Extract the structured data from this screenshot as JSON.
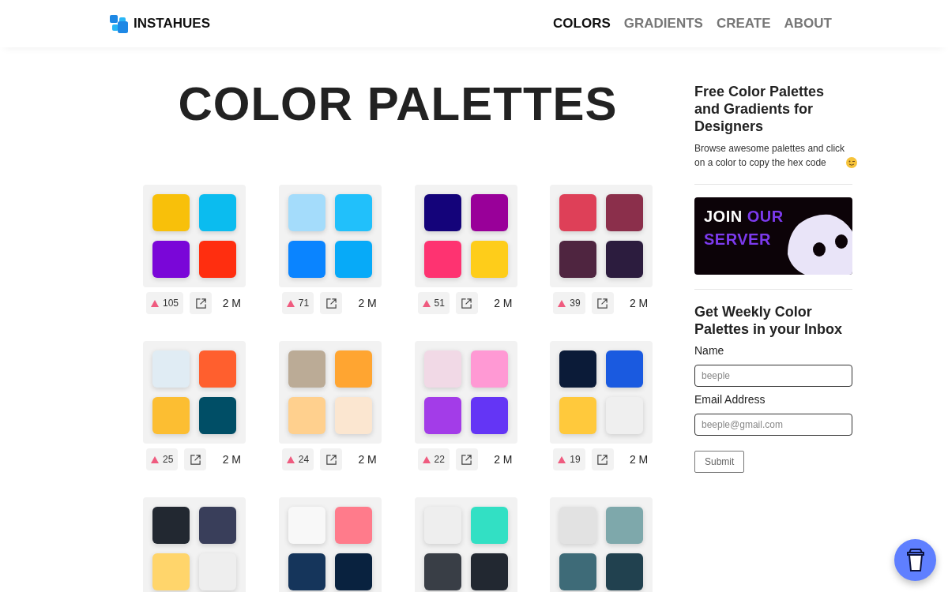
{
  "brand": "INSTAHUES",
  "nav": [
    {
      "label": "COLORS",
      "selected": true
    },
    {
      "label": "GRADIENTS",
      "selected": false
    },
    {
      "label": "CREATE",
      "selected": false
    },
    {
      "label": "ABOUT",
      "selected": false
    }
  ],
  "title": "COLOR PALETTES",
  "palettes": [
    {
      "swatches": [
        {
          "color": "#f8c00a"
        },
        {
          "color": "#0bbcef"
        },
        {
          "color": "#7a06d8"
        },
        {
          "color": "#ff2e0f"
        }
      ],
      "likes": "105",
      "views": "2 M"
    },
    {
      "swatches": [
        {
          "color": "#a4dcfb"
        },
        {
          "color": "#21c0fb"
        },
        {
          "color": "#0a84ff"
        },
        {
          "color": "#07aaf8"
        }
      ],
      "likes": "71",
      "views": "2 M"
    },
    {
      "swatches": [
        {
          "color": "#14037a"
        },
        {
          "color": "#990099"
        },
        {
          "color": "#fe3371"
        },
        {
          "color": "#fecd1a"
        }
      ],
      "likes": "51",
      "views": "2 M"
    },
    {
      "swatches": [
        {
          "color": "#de4058"
        },
        {
          "color": "#8b2f4b"
        },
        {
          "color": "#4f2540"
        },
        {
          "color": "#2c1c3e"
        }
      ],
      "likes": "39",
      "views": "2 M"
    },
    {
      "swatches": [
        {
          "color": "#e0ecf4"
        },
        {
          "color": "#ff5f2e"
        },
        {
          "color": "#fcbe32"
        },
        {
          "color": "#004e66"
        }
      ],
      "likes": "25",
      "views": "2 M"
    },
    {
      "swatches": [
        {
          "color": "#bbab96"
        },
        {
          "color": "#ffa531"
        },
        {
          "color": "#ffd08e"
        },
        {
          "color": "#fbe6d0"
        }
      ],
      "likes": "24",
      "views": "2 M"
    },
    {
      "swatches": [
        {
          "color": "#f1d9e6"
        },
        {
          "color": "#ff99d4"
        },
        {
          "color": "#a33ce8"
        },
        {
          "color": "#6435f5"
        }
      ],
      "likes": "22",
      "views": "2 M"
    },
    {
      "swatches": [
        {
          "color": "#0b1b38"
        },
        {
          "color": "#1a5ae0"
        },
        {
          "color": "#ffc93c"
        },
        {
          "color": "#efefef"
        }
      ],
      "likes": "19",
      "views": "2 M"
    },
    {
      "swatches": [
        {
          "color": "#222831"
        },
        {
          "color": "#393e5a"
        },
        {
          "color": "#ffd56b"
        },
        {
          "color": "#eeeeee"
        }
      ]
    },
    {
      "swatches": [
        {
          "color": "#f8f8f8"
        },
        {
          "color": "#ff7b8b"
        },
        {
          "color": "#15355b"
        },
        {
          "color": "#09223f"
        }
      ]
    },
    {
      "swatches": [
        {
          "color": "#eeeeee"
        },
        {
          "color": "#32e0c4"
        },
        {
          "color": "#393e46"
        },
        {
          "color": "#222831"
        }
      ]
    },
    {
      "swatches": [
        {
          "color": "#e2e2e2"
        },
        {
          "color": "#7ea8ab"
        },
        {
          "color": "#3e6b78"
        },
        {
          "color": "#21414f"
        }
      ]
    }
  ],
  "sidebar": {
    "heading": "Free Color Palettes and Gradients for Designers",
    "text": "Browse awesome palettes and click on a color to copy the hex code",
    "banner": {
      "lines": [
        [
          {
            "text": "JOIN",
            "color": "#ffffff"
          },
          {
            "text": "OUR",
            "color": "#7c3aed"
          }
        ],
        [
          {
            "text": "SERVER",
            "color": "#7c3aed"
          }
        ]
      ]
    },
    "newsletter": {
      "heading": "Get Weekly Color Palettes in your Inbox",
      "fields": [
        {
          "label": "Name",
          "placeholder": "beeple"
        },
        {
          "label": "Email Address",
          "placeholder": "beeple@gmail.com"
        }
      ],
      "submit": "Submit"
    }
  }
}
